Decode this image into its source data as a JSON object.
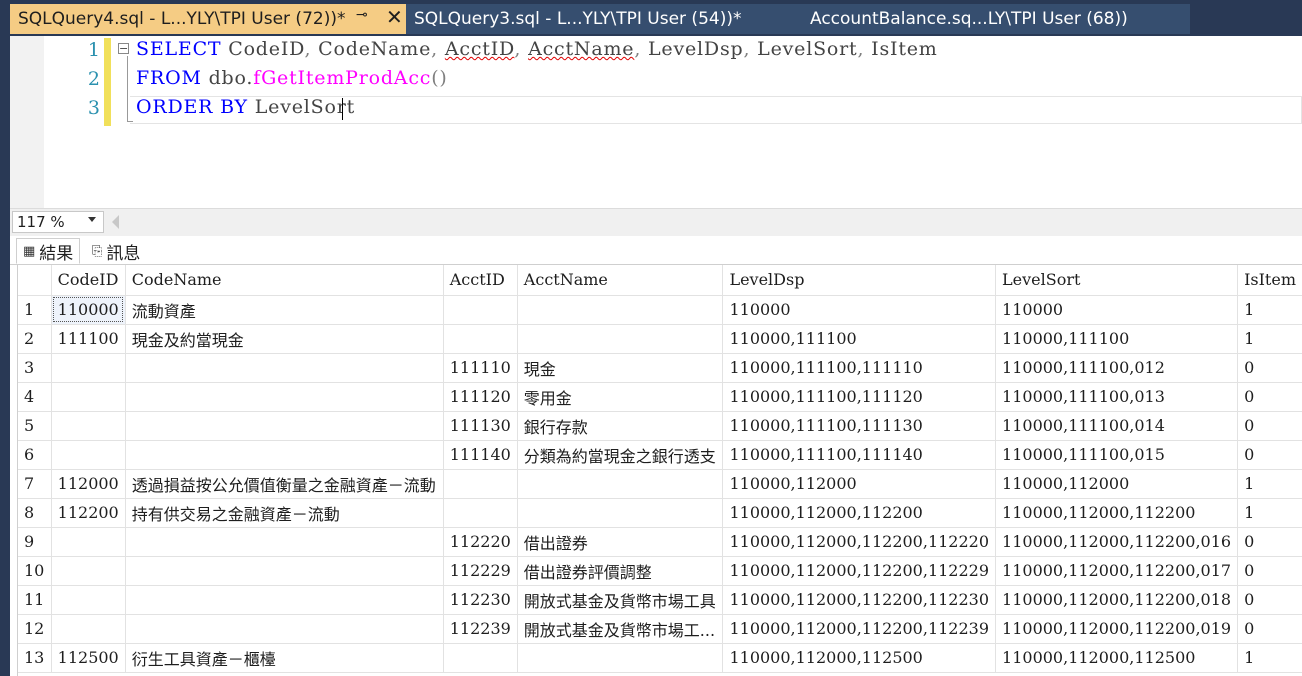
{
  "tabs": [
    {
      "label": "SQLQuery4.sql - L...YLY\\TPI User (72))*",
      "active": true
    },
    {
      "label": "SQLQuery3.sql - L...YLY\\TPI User (54))*",
      "active": false
    },
    {
      "label": "AccountBalance.sq...LY\\TPI User (68))",
      "active": false
    }
  ],
  "tab_pin_glyph": "⊸",
  "tab_close_glyph": "✕",
  "editor": {
    "line_numbers": [
      "1",
      "2",
      "3"
    ],
    "line1": {
      "kw": "SELECT",
      "t1": " CodeID",
      "c1": ",",
      "t2": " CodeName",
      "c2": ",",
      "sp3": " ",
      "t3": "AcctID",
      "c3": ",",
      "sp4": " ",
      "t4": "AcctName",
      "c4": ",",
      "t5": " LevelDsp",
      "c5": ",",
      "t6": " LevelSort",
      "c6": ",",
      "t7": " IsItem"
    },
    "line2": {
      "kw": "FROM",
      "t1": " dbo.",
      "fn": "fGetItemProdAcc",
      "p": "()"
    },
    "line3": {
      "kw": "ORDER BY",
      "t1": " LevelSort"
    },
    "fold_glyph": "−"
  },
  "zoom": {
    "value": "117 %"
  },
  "result_tabs": [
    {
      "label": "結果",
      "icon": "grid-icon",
      "active": true
    },
    {
      "label": "訊息",
      "icon": "messages-icon",
      "active": false
    }
  ],
  "grid": {
    "columns": [
      "",
      "CodeID",
      "CodeName",
      "AcctID",
      "AcctName",
      "LevelDsp",
      "LevelSort",
      "IsItem"
    ],
    "rows": [
      [
        "1",
        "110000",
        "流動資產",
        "",
        "",
        "110000",
        "110000",
        "1"
      ],
      [
        "2",
        "111100",
        "現金及約當現金",
        "",
        "",
        "110000,111100",
        "110000,111100",
        "1"
      ],
      [
        "3",
        "",
        "",
        "111110",
        "現金",
        "110000,111100,111110",
        "110000,111100,012",
        "0"
      ],
      [
        "4",
        "",
        "",
        "111120",
        "零用金",
        "110000,111100,111120",
        "110000,111100,013",
        "0"
      ],
      [
        "5",
        "",
        "",
        "111130",
        "銀行存款",
        "110000,111100,111130",
        "110000,111100,014",
        "0"
      ],
      [
        "6",
        "",
        "",
        "111140",
        "分類為約當現金之銀行透支",
        "110000,111100,111140",
        "110000,111100,015",
        "0"
      ],
      [
        "7",
        "112000",
        "透過損益按公允價值衡量之金融資產－流動",
        "",
        "",
        "110000,112000",
        "110000,112000",
        "1"
      ],
      [
        "8",
        "112200",
        "持有供交易之金融資產－流動",
        "",
        "",
        "110000,112000,112200",
        "110000,112000,112200",
        "1"
      ],
      [
        "9",
        "",
        "",
        "112220",
        "借出證券",
        "110000,112000,112200,112220",
        "110000,112000,112200,016",
        "0"
      ],
      [
        "10",
        "",
        "",
        "112229",
        "借出證券評價調整",
        "110000,112000,112200,112229",
        "110000,112000,112200,017",
        "0"
      ],
      [
        "11",
        "",
        "",
        "112230",
        "開放式基金及貨幣市場工具",
        "110000,112000,112200,112230",
        "110000,112000,112200,018",
        "0"
      ],
      [
        "12",
        "",
        "",
        "112239",
        "開放式基金及貨幣市場工...",
        "110000,112000,112200,112239",
        "110000,112000,112200,019",
        "0"
      ],
      [
        "13",
        "112500",
        "衍生工具資產－櫃檯",
        "",
        "",
        "110000,112000,112500",
        "110000,112000,112500",
        "1"
      ]
    ]
  },
  "colors": {
    "tabbar": "#293955",
    "active_tab": "#f5cc84",
    "keyword": "#0000ff",
    "function": "#ff00ff",
    "line_number": "#2b91af"
  }
}
